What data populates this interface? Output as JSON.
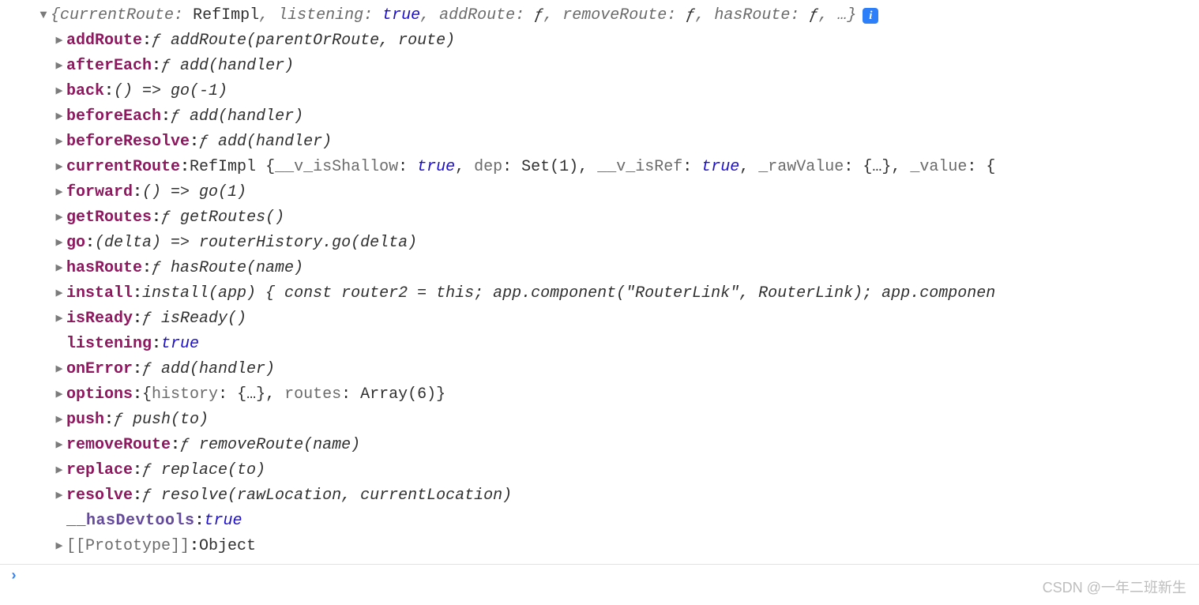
{
  "summary": {
    "pairs": [
      {
        "k": "currentRoute",
        "v": "RefImpl",
        "vc": "plain"
      },
      {
        "k": "listening",
        "v": "true",
        "vc": "bool"
      },
      {
        "k": "addRoute",
        "v": "ƒ",
        "vc": "fsig"
      },
      {
        "k": "removeRoute",
        "v": "ƒ",
        "vc": "fsig"
      },
      {
        "k": "hasRoute",
        "v": "ƒ",
        "vc": "fsig"
      }
    ],
    "tail": ", …}"
  },
  "props": [
    {
      "tri": "right",
      "key": "addRoute",
      "kc": "key",
      "fn": "ƒ addRoute(parentOrRoute, route)"
    },
    {
      "tri": "right",
      "key": "afterEach",
      "kc": "key",
      "fn": "ƒ add(handler)"
    },
    {
      "tri": "right",
      "key": "back",
      "kc": "key",
      "fn": "() => go(-1)"
    },
    {
      "tri": "right",
      "key": "beforeEach",
      "kc": "key",
      "fn": "ƒ add(handler)"
    },
    {
      "tri": "right",
      "key": "beforeResolve",
      "kc": "key",
      "fn": "ƒ add(handler)"
    },
    {
      "tri": "right",
      "key": "currentRoute",
      "kc": "key",
      "inline": [
        {
          "t": "RefImpl {",
          "c": "plain"
        },
        {
          "t": "__v_isShallow",
          "c": "graykey"
        },
        {
          "t": ": ",
          "c": "plain"
        },
        {
          "t": "true",
          "c": "bool"
        },
        {
          "t": ", ",
          "c": "plain"
        },
        {
          "t": "dep",
          "c": "graykey"
        },
        {
          "t": ": Set(1), ",
          "c": "plain"
        },
        {
          "t": "__v_isRef",
          "c": "graykey"
        },
        {
          "t": ": ",
          "c": "plain"
        },
        {
          "t": "true",
          "c": "bool"
        },
        {
          "t": ", ",
          "c": "plain"
        },
        {
          "t": "_rawValue",
          "c": "graykey"
        },
        {
          "t": ": {…}, ",
          "c": "plain"
        },
        {
          "t": "_value",
          "c": "graykey"
        },
        {
          "t": ": {",
          "c": "plain"
        }
      ]
    },
    {
      "tri": "right",
      "key": "forward",
      "kc": "key",
      "fn": "() => go(1)"
    },
    {
      "tri": "right",
      "key": "getRoutes",
      "kc": "key",
      "fn": "ƒ getRoutes()"
    },
    {
      "tri": "right",
      "key": "go",
      "kc": "key",
      "fn": "(delta) => routerHistory.go(delta)"
    },
    {
      "tri": "right",
      "key": "hasRoute",
      "kc": "key",
      "fn": "ƒ hasRoute(name)"
    },
    {
      "tri": "right",
      "key": "install",
      "kc": "key",
      "fn": "install(app) { const router2 = this; app.component(\"RouterLink\", RouterLink); app.componen"
    },
    {
      "tri": "right",
      "key": "isReady",
      "kc": "key",
      "fn": "ƒ isReady()"
    },
    {
      "tri": "none",
      "key": "listening",
      "kc": "key",
      "inline": [
        {
          "t": "true",
          "c": "bool"
        }
      ]
    },
    {
      "tri": "right",
      "key": "onError",
      "kc": "key",
      "fn": "ƒ add(handler)"
    },
    {
      "tri": "right",
      "key": "options",
      "kc": "key",
      "inline": [
        {
          "t": "{",
          "c": "plain"
        },
        {
          "t": "history",
          "c": "graykey"
        },
        {
          "t": ": {…}, ",
          "c": "plain"
        },
        {
          "t": "routes",
          "c": "graykey"
        },
        {
          "t": ": Array(6)}",
          "c": "plain"
        }
      ]
    },
    {
      "tri": "right",
      "key": "push",
      "kc": "key",
      "fn": "ƒ push(to)"
    },
    {
      "tri": "right",
      "key": "removeRoute",
      "kc": "key",
      "fn": "ƒ removeRoute(name)"
    },
    {
      "tri": "right",
      "key": "replace",
      "kc": "key",
      "fn": "ƒ replace(to)"
    },
    {
      "tri": "right",
      "key": "resolve",
      "kc": "key",
      "fn": "ƒ resolve(rawLocation, currentLocation)"
    },
    {
      "tri": "none",
      "key": "__hasDevtools",
      "kc": "key2",
      "inline": [
        {
          "t": "true",
          "c": "bool"
        }
      ]
    },
    {
      "tri": "right",
      "key": "[[Prototype]]",
      "kc": "graykey",
      "inline": [
        {
          "t": "Object",
          "c": "plain"
        }
      ]
    }
  ],
  "promptGlyph": "›",
  "watermark": "CSDN @一年二班新生"
}
